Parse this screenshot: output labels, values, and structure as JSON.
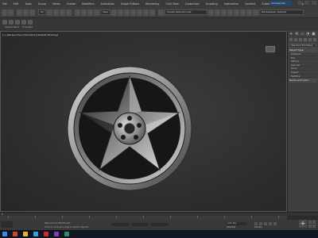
{
  "menu": [
    "File",
    "Edit",
    "Tools",
    "Group",
    "Views",
    "Create",
    "Modifiers",
    "Animation",
    "Graph Editors",
    "Rendering",
    "Civil View",
    "Customize",
    "Scripting",
    "Interactive",
    "Content",
    "Substance",
    "Arnold",
    "Help"
  ],
  "sign_in": "ramasander",
  "toolbar": {
    "selection_filter": "All",
    "view_dropdown": "View",
    "named_selection": "Create Selection Set",
    "workspaces": "Workspaces: Default"
  },
  "ribbon_tabs": [
    "Object Paint",
    "Populate"
  ],
  "viewport": {
    "label": "[+] [Perspective] [Standard] [Default Shading]"
  },
  "command_panel": {
    "tabs": [
      "+",
      "⟲",
      "▭",
      "◔",
      "▣",
      "🔧"
    ],
    "category_dropdown": "Standard Primitives",
    "rollout_object_type": "Object Type",
    "autogrid": "AutoGrid",
    "object_types": [
      "Box",
      "Sphere",
      "Cylinder",
      "Torus",
      "Teapot",
      "TextPlus"
    ],
    "rollout_name_color": "Name and Color"
  },
  "timeline": {
    "frame_start": "0",
    "ticks": [
      "0",
      "10",
      "20",
      "30",
      "40",
      "50",
      "60",
      "70",
      "80",
      "90",
      "100"
    ]
  },
  "status": {
    "welcome": "Welcome to MAXScript.",
    "prompt": "Click or click-and-drag to select objects",
    "auto_key": "Auto Key",
    "selected": "Selected",
    "set_key": "Set Key",
    "key_filters": "Key Filters...",
    "add_time_tag": "Add Time Tag"
  },
  "wheel_colors": {
    "rim_light": "#d4d4d4",
    "rim_dark": "#454545",
    "spoke_light": "#e6e6e6",
    "spoke_dark": "#1a1a1a",
    "accent": "#24456e"
  }
}
